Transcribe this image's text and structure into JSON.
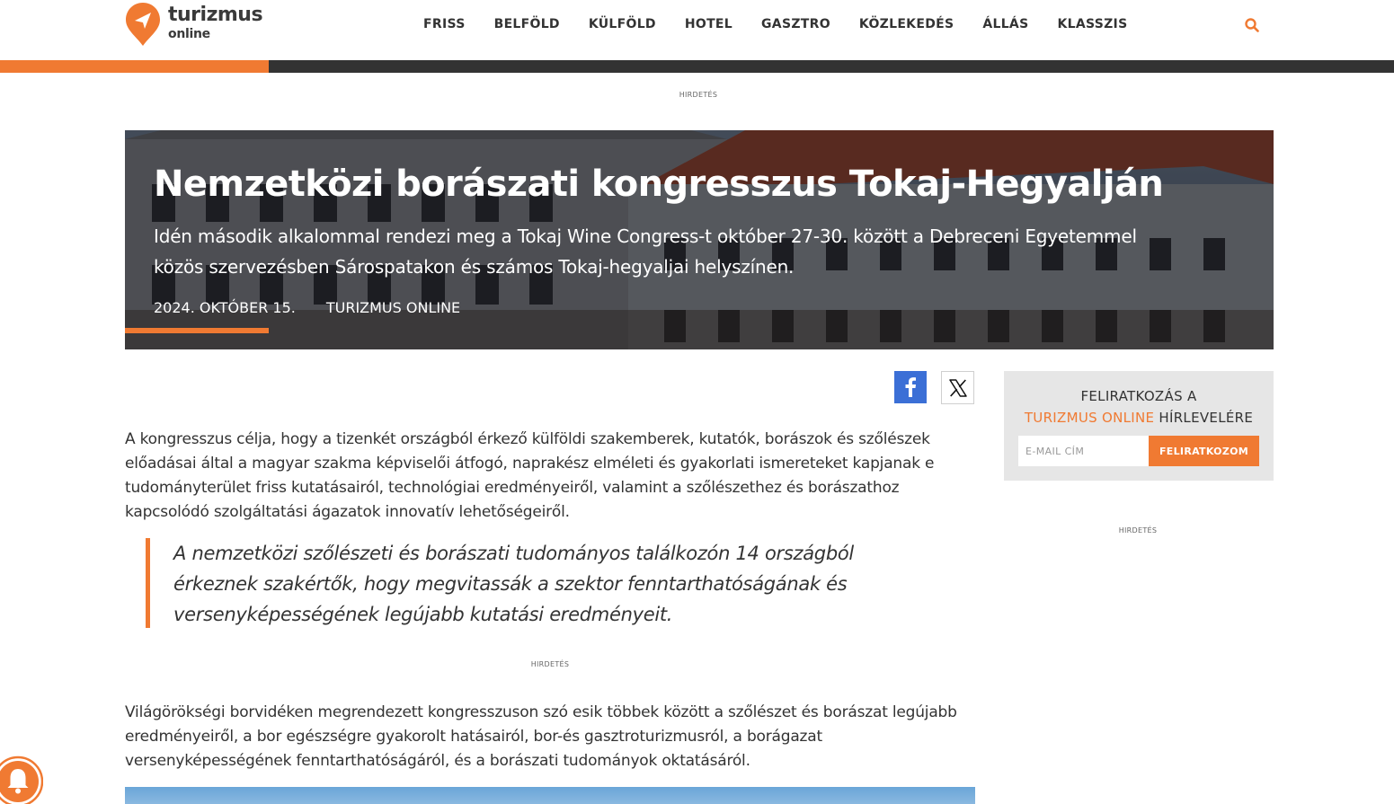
{
  "header": {
    "logo_word": "turizmus",
    "logo_sub": "online",
    "nav": [
      "FRISS",
      "BELFÖLD",
      "KÜLFÖLD",
      "HOTEL",
      "GASZTRO",
      "KÖZLEKEDÉS",
      "ÁLLÁS",
      "KLASSZIS"
    ],
    "search_icon": "search-icon"
  },
  "colors": {
    "accent": "#f07a32",
    "dark": "#333333",
    "facebook": "#3b6fd6"
  },
  "ads": {
    "label": "HIRDETÉS"
  },
  "hero": {
    "title": "Nemzetközi borászati kongresszus Tokaj-Hegyalján",
    "lead": "Idén második alkalommal rendezi meg a Tokaj Wine Congress-t október 27-30. között a Debreceni Egyetemmel közös szervezésben Sárospatakon és számos Tokaj-hegyaljai helyszínen.",
    "date": "2024. OKTÓBER 15.",
    "author": "TURIZMUS ONLINE"
  },
  "share": {
    "facebook_icon": "facebook-icon",
    "x_icon": "x-icon"
  },
  "article": {
    "p1": "A kongresszus célja, hogy a tizenkét országból érkező külföldi szakemberek, kutatók, borászok és szőlészek előadásai által a magyar szakma képviselői átfogó, naprakész elméleti és gyakorlati ismereteket kapjanak e tudományterület friss kutatásairól, technológiai eredményeiről, valamint a szőlészethez és borászathoz kapcsolódó szolgáltatási ágazatok innovatív lehetőségeiről.",
    "quote": "A nemzetközi szőlészeti és borászati tudományos találkozón 14 országból érkeznek szakértők, hogy megvitassák a szektor fenntarthatóságának és versenyképességének legújabb kutatási eredményeit.",
    "p2": "Világörökségi borvidéken megrendezett kongresszuson szó esik többek között a szőlészet és borászat legújabb eredményeiről, a bor egészségre gyakorolt hatásairól, bor-és gasztroturizmusról, a borágazat versenyképességének fenntarthatóságáról, és a borászati tudományok oktatásáról."
  },
  "newsletter": {
    "line1": "FELIRATKOZÁS A",
    "brand": "TURIZMUS ONLINE",
    "line2_rest": " HÍRLEVELÉRE",
    "placeholder": "E-MAIL CÍM",
    "button": "FELIRATKOZOM"
  }
}
